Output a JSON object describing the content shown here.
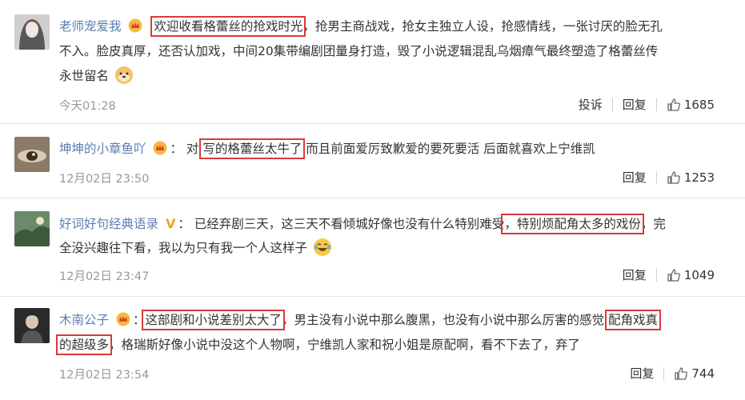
{
  "comments": [
    {
      "username": "老师宠爱我",
      "badge": "crown",
      "lines": [
        [
          "欢迎收看格蕾丝的抢戏时光",
          "，抢男主商战戏，抢女主独立人设，抢感情线，一张讨厌的脸无孔"
        ],
        [
          "不入。脸皮真厚，还否认加戏，中间20集带编剧团量身打造，毁了小说逻辑混乱乌烟瘴气最终塑造了格蕾丝传"
        ],
        [
          "永世留名"
        ]
      ],
      "time": "今天01:28",
      "report_label": "投诉",
      "reply_label": "回复",
      "likes": "1685"
    },
    {
      "username": "坤坤的小章鱼吖",
      "badge": "crown",
      "colon": "：",
      "pre": "对 ",
      "highlight": "写的格蕾丝太牛了",
      "rest": "而且前面爱厉致歉爱的要死要活 后面就喜欢上宁维凯",
      "time": "12月02日 23:50",
      "reply_label": "回复",
      "likes": "1253"
    },
    {
      "username": "好词好句经典语录",
      "badge": "V",
      "colon": "：",
      "pre": "已经弃剧三天，这三天不看倾城好像也没有什么特别难受",
      "highlight": "，特别烦配角太多的戏份",
      "post": "，完",
      "line2": "全没兴趣往下看，我以为只有我一个人这样子",
      "time": "12月02日 23:47",
      "reply_label": "回复",
      "likes": "1049"
    },
    {
      "username": "木南公子",
      "badge": "crown",
      "colon": "：",
      "highlight": "这部剧和小说差别太大了",
      "rest": "，男主没有小说中那么腹黑，也没有小说中那么厉害的感觉",
      "highlight2a": "配角戏真",
      "highlight2b": "的超级多",
      "line2rest": "，格瑞斯好像小说中没这个人物啊，宁维凯人家和祝小姐是原配啊，看不下去了，弃了",
      "time": "12月02日 23:54",
      "reply_label": "回复",
      "likes": "744"
    }
  ],
  "colors": {
    "username": "#5a7fb0",
    "highlight_box": "#d93a3a",
    "meta": "#999999"
  },
  "icons": [
    "crown-badge-icon",
    "verified-v-icon",
    "doge-emoji-icon",
    "laugh-cry-emoji-icon",
    "thumbs-up-icon"
  ]
}
